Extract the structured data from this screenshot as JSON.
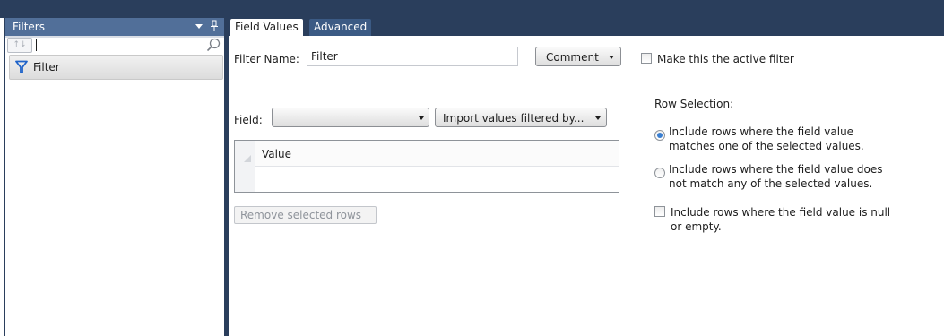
{
  "filters_panel": {
    "title": "Filters",
    "sort_button": "↑↓",
    "search_value": "",
    "items": [
      {
        "label": "Filter",
        "icon": "filter-funnel-icon"
      }
    ]
  },
  "tabs": [
    {
      "label": "Field Values",
      "active": true
    },
    {
      "label": "Advanced",
      "active": false
    }
  ],
  "field_values": {
    "filter_name_label": "Filter Name:",
    "filter_name_value": "Filter",
    "comment_button": "Comment",
    "active_filter_label": "Make this the active filter",
    "active_filter_checked": false,
    "field_label": "Field:",
    "field_select_value": "",
    "import_button": "Import values filtered by...",
    "grid": {
      "column_header": "Value",
      "rows": []
    },
    "remove_button": "Remove selected rows",
    "row_selection": {
      "title": "Row Selection:",
      "options": [
        {
          "line1": "Include rows where the field value",
          "line2": "matches one of the selected values.",
          "selected": true
        },
        {
          "line1": "Include rows where the field value does",
          "line2": "not match any of the selected values.",
          "selected": false
        }
      ],
      "include_null_line1": "Include rows where the field value is null",
      "include_null_line2": "or empty.",
      "include_null_checked": false
    }
  },
  "colors": {
    "header_dark": "#2a3e5c",
    "panel_header": "#516f99",
    "radio_selected": "#3a7fd1"
  }
}
